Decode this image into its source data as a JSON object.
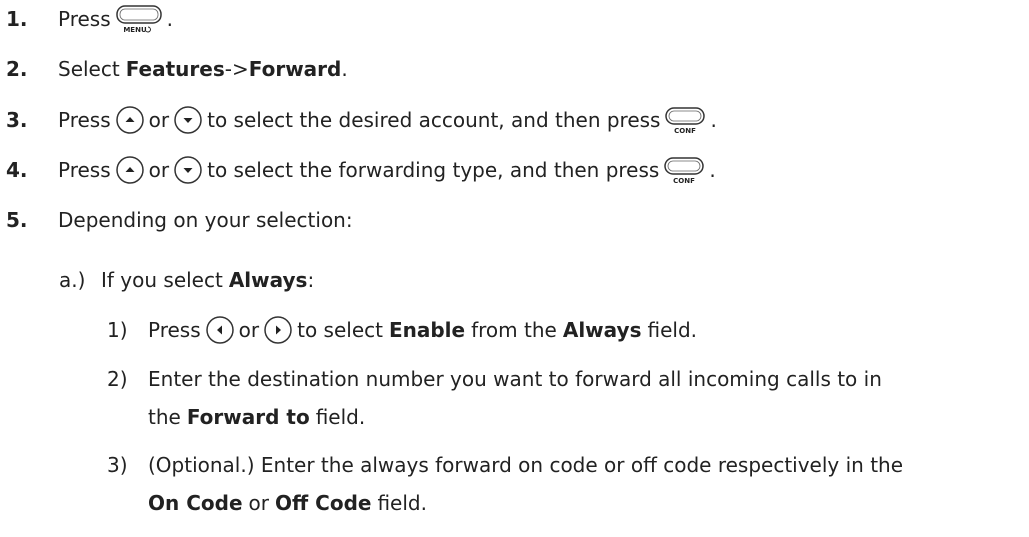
{
  "steps": [
    {
      "num": "1.",
      "pre": "Press",
      "post": "."
    },
    {
      "num": "2.",
      "pre": "Select",
      "b1": "Features",
      "arrow": "->",
      "b2": "Forward",
      "post": "."
    },
    {
      "num": "3.",
      "pre": "Press",
      "mid": "or",
      "post": "to select the desired account, and then press",
      "end": "."
    },
    {
      "num": "4.",
      "pre": "Press",
      "mid": "or",
      "post": "to select the forwarding type, and then press",
      "end": "."
    },
    {
      "num": "5.",
      "text": "Depending on your selection:"
    }
  ],
  "sub_a": {
    "label": "a.)",
    "pre": "If you select",
    "b": "Always",
    "post": ":"
  },
  "sub_items": [
    {
      "num": "1)",
      "pre": "Press",
      "mid": "or",
      "post1": "to select",
      "b1": "Enable",
      "post2": "from the",
      "b2": "Always",
      "post3": "field."
    },
    {
      "num": "2)",
      "line1": "Enter the destination number you want to forward all incoming calls to in",
      "line2_pre": "the",
      "line2_b": "Forward to",
      "line2_post": "field."
    },
    {
      "num": "3)",
      "line1": "(Optional.) Enter the always forward on code or off code respectively in the",
      "line2_b1": "On Code",
      "line2_mid": "or",
      "line2_b2": "Off Code",
      "line2_post": "field."
    }
  ],
  "keys": {
    "menu": "MENU",
    "conf": "CONF"
  }
}
